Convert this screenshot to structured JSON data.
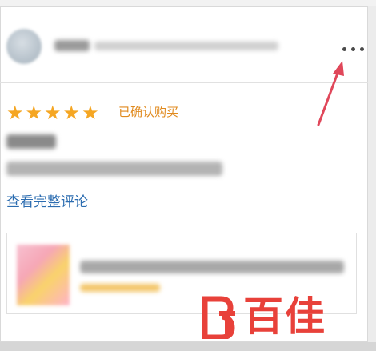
{
  "review": {
    "verified_label": "已确认购买",
    "full_review_link": "查看完整评论",
    "rating_stars": 5
  },
  "more_menu": {
    "icon": "more-horizontal-icon"
  },
  "annotation": {
    "color": "#e0475a"
  },
  "watermark": {
    "text": "百佳",
    "color": "#e8413a"
  }
}
